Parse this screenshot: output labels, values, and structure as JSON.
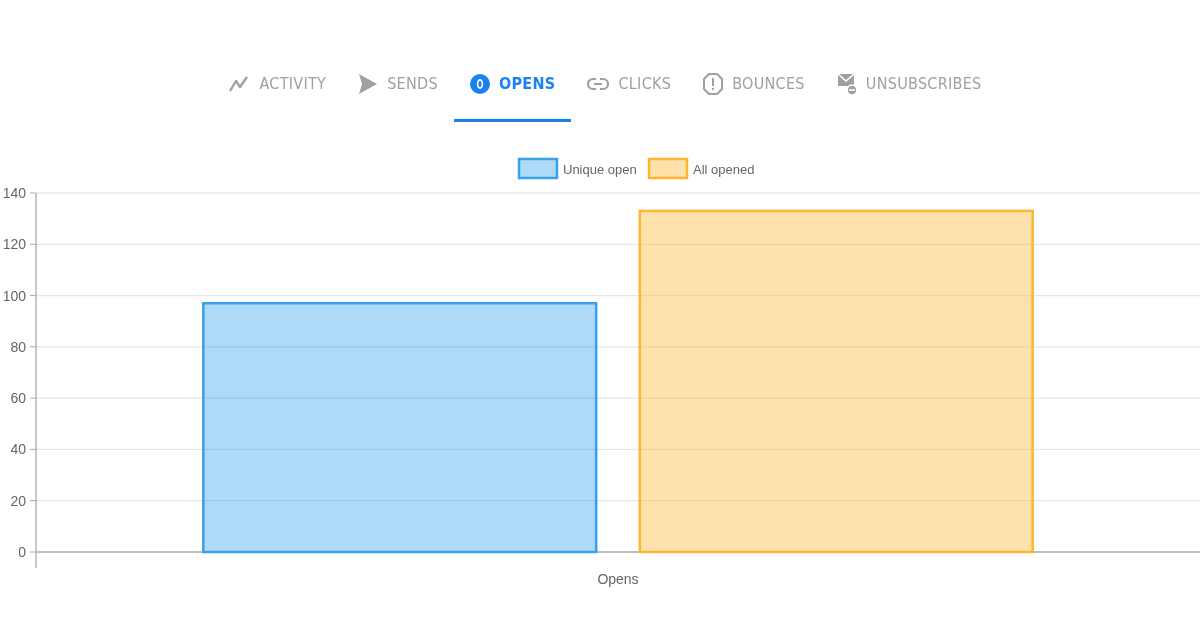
{
  "tabs": [
    {
      "label": "ACTIVITY",
      "kind": "activity",
      "selected": false
    },
    {
      "label": "SENDS",
      "kind": "sends",
      "selected": false
    },
    {
      "label": "OPENS",
      "kind": "opens",
      "selected": true
    },
    {
      "label": "CLICKS",
      "kind": "clicks",
      "selected": false
    },
    {
      "label": "BOUNCES",
      "kind": "bounces",
      "selected": false
    },
    {
      "label": "UNSUBSCRIBES",
      "kind": "unsubscribes",
      "selected": false
    }
  ],
  "chart_data": {
    "type": "bar",
    "categories": [
      "Opens"
    ],
    "series": [
      {
        "name": "Unique open",
        "color": "#36a2eb",
        "values": [
          97
        ]
      },
      {
        "name": "All opened",
        "color": "#ffb530",
        "values": [
          133
        ]
      }
    ],
    "legend": "top",
    "grid": true,
    "ylim": [
      0,
      140
    ],
    "yticks": [
      0,
      20,
      40,
      60,
      80,
      100,
      120,
      140
    ]
  }
}
